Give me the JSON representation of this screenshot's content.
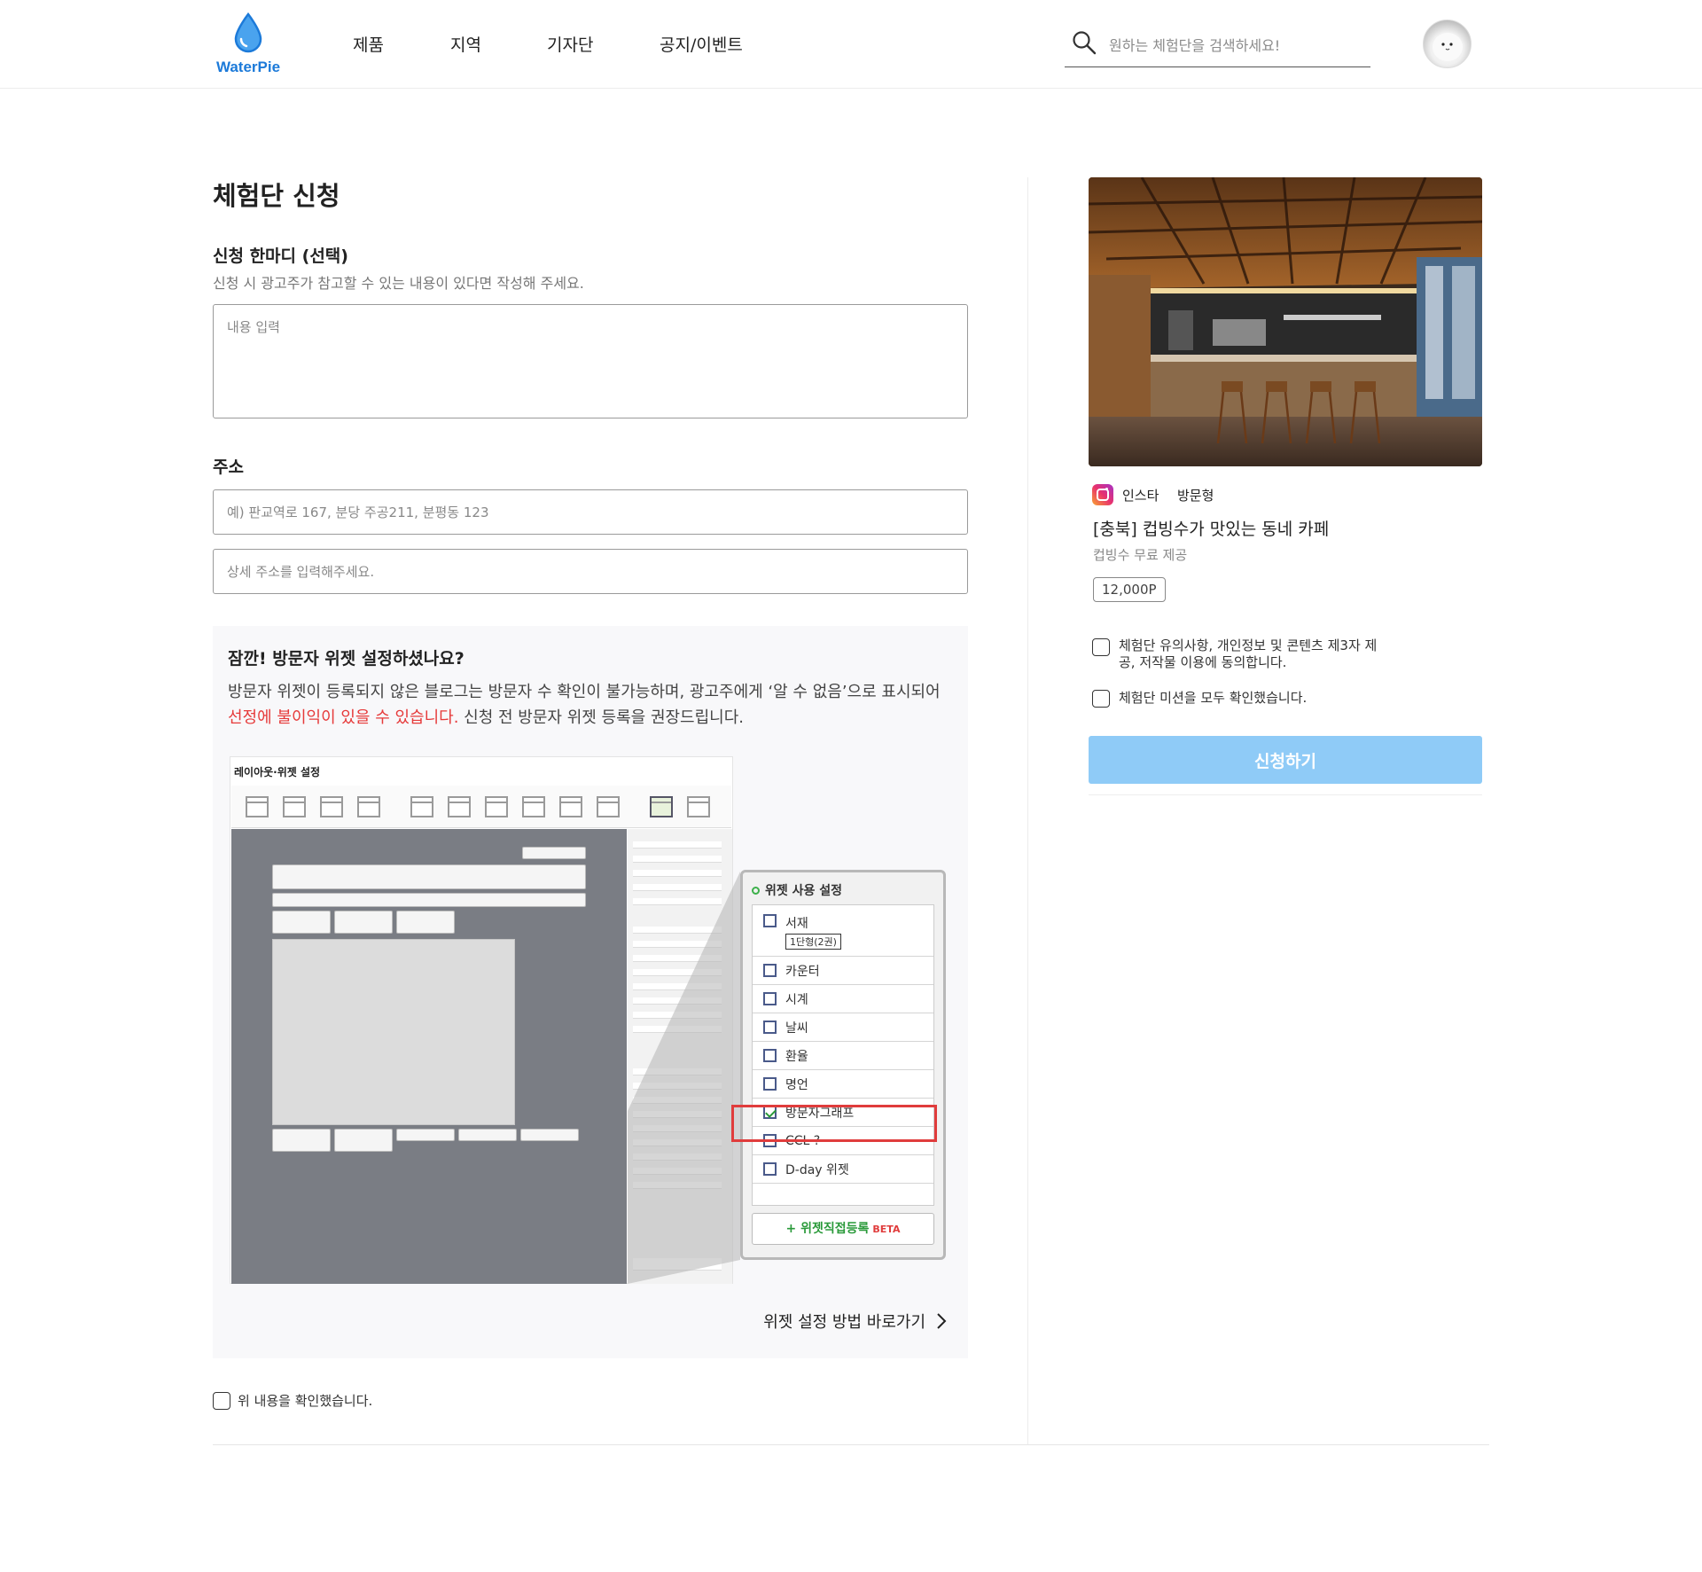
{
  "header": {
    "logo_text": "WaterPie",
    "nav": [
      "제품",
      "지역",
      "기자단",
      "공지/이벤트"
    ],
    "search_placeholder": "원하는 체험단을 검색하세요!",
    "brand_color": "#1c7ad9"
  },
  "form": {
    "page_title": "체험단 신청",
    "comment_title": "신청 한마디 (선택)",
    "comment_desc": "신청 시 광고주가 참고할 수 있는 내용이 있다면 작성해 주세요.",
    "comment_placeholder": "내용 입력",
    "address_title": "주소",
    "address_placeholder": "예) 판교역로 167, 분당 주공211, 분평동 123",
    "address_detail_placeholder": "상세 주소를 입력해주세요."
  },
  "notice": {
    "title": "잠깐! 방문자 위젯 설정하셨나요?",
    "body_part1": "방문자 위젯이 등록되지 않은 블로그는 방문자 수 확인이 불가능하며, 광고주에게 ‘알 수 없음’으로 표시되어 ",
    "body_red": "선정에 불이익이 있을 수 있습니다.",
    "body_part2": " 신청 전 방문자 위젯 등록을 권장드립니다.",
    "red_color": "#e63a3a",
    "link_label": "위젯 설정 방법 바로가기",
    "illustration": {
      "caption": "레이아웃·위젯 설정",
      "panel_title": "위젯 사용 설정",
      "items": [
        {
          "label": "서재",
          "checked": false,
          "extra": "1단형(2권)"
        },
        {
          "label": "카운터",
          "checked": false
        },
        {
          "label": "시계",
          "checked": false
        },
        {
          "label": "날씨",
          "checked": false
        },
        {
          "label": "환율",
          "checked": false
        },
        {
          "label": "명언",
          "checked": false
        },
        {
          "label": "방문자그래프",
          "checked": true
        },
        {
          "label": "CCL ?",
          "checked": false
        },
        {
          "label": "D-day 위젯",
          "checked": false
        }
      ],
      "add_button": "+ 위젯직접등록",
      "beta": "BETA"
    },
    "confirm_label": "위 내용을 확인했습니다."
  },
  "campaign": {
    "platform": "인스타",
    "type": "방문형",
    "title": "[충북] 컵빙수가 맛있는 동네 카페",
    "subtitle": "컵빙수 무료 제공",
    "points": "12,000P",
    "agree_terms": "체험단 유의사항, 개인정보 및 콘텐츠 제3자 제공, 저작물 이용에 동의합니다.",
    "agree_mission": "체험단 미션을 모두 확인했습니다.",
    "submit_label": "신청하기",
    "submit_color": "#8fcbf7"
  }
}
